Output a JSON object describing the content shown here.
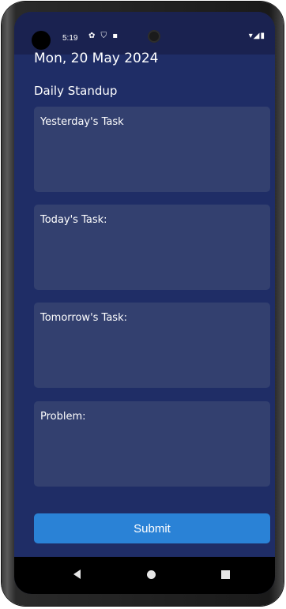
{
  "status_bar": {
    "time": "5:19",
    "left_icons": "✿ ⛉ ▪",
    "right_icons": "▾◢▮"
  },
  "header": {
    "date": "Mon, 20 May 2024",
    "title": "Daily Standup"
  },
  "form": {
    "fields": [
      {
        "label": "Yesterday's Task",
        "value": ""
      },
      {
        "label": "Today's Task:",
        "value": ""
      },
      {
        "label": "Tomorrow's Task:",
        "value": ""
      },
      {
        "label": "Problem:",
        "value": ""
      }
    ],
    "submit_label": "Submit"
  },
  "colors": {
    "background": "#1f2d66",
    "field": "#33406f",
    "button": "#2a82d6"
  }
}
